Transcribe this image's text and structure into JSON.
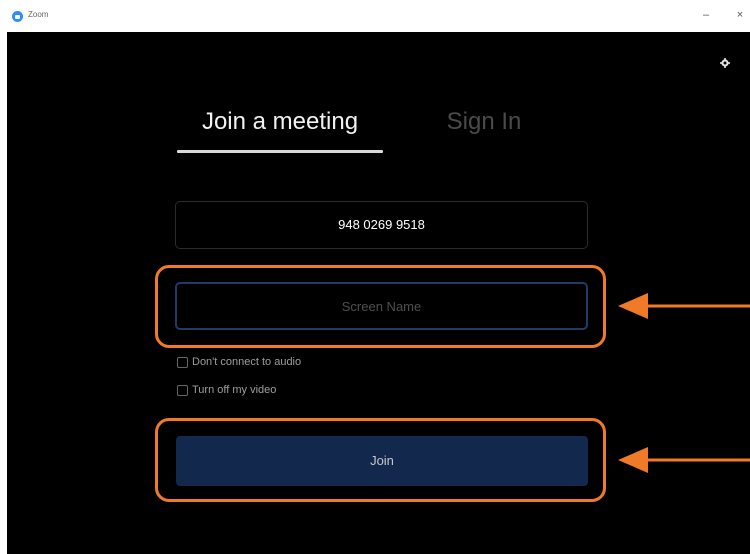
{
  "window": {
    "title": "Zoom",
    "minimize_glyph": "–",
    "close_glyph": "×"
  },
  "tabs": [
    {
      "label": "Join a meeting",
      "active": true
    },
    {
      "label": "Sign In",
      "active": false
    }
  ],
  "meeting_id": {
    "value": "948 0269 9518"
  },
  "screen_name": {
    "value": "",
    "placeholder": "Screen Name"
  },
  "options": [
    {
      "label": "Don't connect to audio",
      "checked": false
    },
    {
      "label": "Turn off my video",
      "checked": false
    }
  ],
  "join_button": {
    "label": "Join"
  },
  "icons": {
    "app": "zoom-logo-icon",
    "settings": "gear-icon",
    "annotation": "arrow-left-icon"
  },
  "colors": {
    "background": "#000000",
    "highlight": "#f07a28",
    "join_button": "#12294d",
    "screen_name_border": "#1f3b66",
    "zoom_blue": "#2d8cff"
  }
}
